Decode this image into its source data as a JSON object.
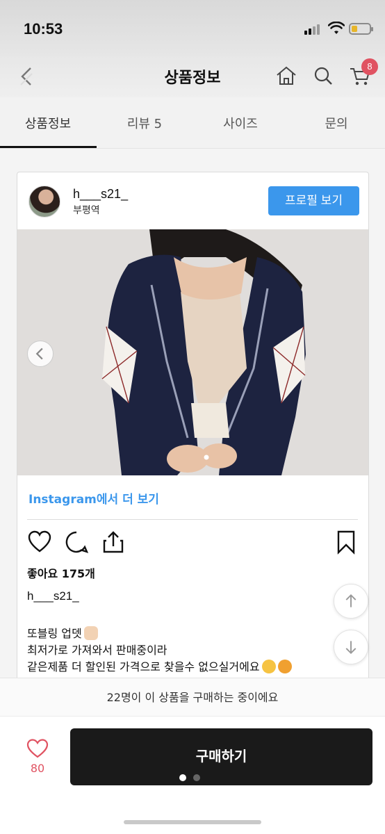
{
  "status": {
    "time": "10:53"
  },
  "header": {
    "title": "상품정보",
    "cart_count": "8"
  },
  "tabs": [
    {
      "label": "상품정보"
    },
    {
      "label": "리뷰 5"
    },
    {
      "label": "사이즈"
    },
    {
      "label": "문의"
    }
  ],
  "post": {
    "username": "h___s21_",
    "location": "부평역",
    "profile_button": "프로필 보기",
    "instagram_link": "Instagram에서 더 보기",
    "likes": "좋아요 175개",
    "caption_user": "h___s21_",
    "caption_lines": [
      "또블링 업뎃",
      "최저가로 가져와서 판매중이라",
      "같은제품 더 할인된 가격으로 찾을수 없으실거에요"
    ]
  },
  "banner": {
    "text": "22명이 이 상품을 구매하는 중이에요"
  },
  "bottom": {
    "wishlist_count": "80",
    "buy_label": "구매하기"
  },
  "colors": {
    "accent_blue": "#3b97ec",
    "badge_red": "#e05362",
    "buy_bg": "#1a1a1a"
  }
}
